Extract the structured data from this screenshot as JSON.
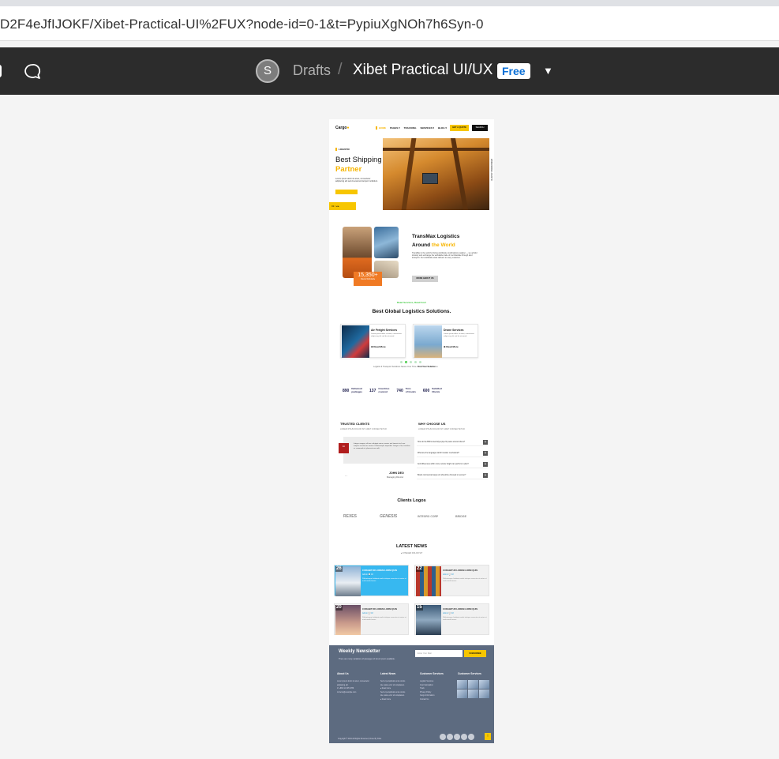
{
  "browser": {
    "url": "D2F4eJfIJOKF/Xibet-Practical-UI%2FUX?node-id=0-1&t=PypiuXgNOh7h6Syn-0"
  },
  "figma": {
    "avatar_initial": "S",
    "breadcrumb_drafts": "Drafts",
    "separator": "/",
    "file_title": "Xibet Practical UI/UX",
    "plan_badge": "Free",
    "chevron": "⌄"
  },
  "design": {
    "nav": {
      "logo_prefix": "Cargo",
      "logo_suffix": "●",
      "items": [
        "HOME",
        "PAGES ▾",
        "TRACKING",
        "SERVICES ▾",
        "BLOG ▾"
      ],
      "cta": "GET A QUOTE",
      "search": "SEARCH"
    },
    "hero": {
      "tag": "LOGISTIC",
      "title_line1": "Best Shipping",
      "title_line2": "Partner",
      "paragraph": "Lorem ipsum dolor sit amet, consectetur adipiscing elit sed do eiusmod tempor incididunt.",
      "side_text": "WORLDWIDE LOGISTIC",
      "controls": "01 / ◂ ▸"
    },
    "about": {
      "stat_number": "15,350+",
      "stat_label": "Clients Worldwide",
      "title_line1": "TransMax Logistics",
      "title_line2_prefix": "Around ",
      "title_line2_accent": "the World",
      "paragraph": "TransMax is the world's driving worldwide coordinations supplier — we uphold industry and exchange the worldwide trade of merchandise through land transport. Our worldwide scale delivers to every customer.",
      "button": "MORE ABOUT US"
    },
    "services": {
      "tag": "Read Services, Read Con!",
      "title": "Best Global Logistics Solutions.",
      "cards": [
        {
          "title": "Air Freight Services",
          "desc": "Lorem ipsum dolor sit amet, consectetur adipiscing elit sed do eiusmod.",
          "link": "Read More"
        },
        {
          "title": "Drone Services",
          "desc": "Lorem ipsum dolor sit amet, consectetur adipiscing elit sed do eiusmod.",
          "link": "Read More"
        }
      ],
      "footer_text": "Logistic & Transport Solutions Saves Your Time.",
      "footer_link": "Find Your Solution"
    },
    "counters": [
      {
        "number": "890",
        "label_1": "Delivered",
        "label_2": "packages"
      },
      {
        "number": "137",
        "label_1": "Countries",
        "label_2": "covered"
      },
      {
        "number": "740",
        "label_1": "Tons",
        "label_2": "of Goods"
      },
      {
        "number": "600",
        "label_1": "Satisfied",
        "label_2": "Clients"
      }
    ],
    "clients": {
      "title": "TRUSTED CLIENTS",
      "subtitle": "LOREM IPSUM DOLOR SIT AMET CONSECTETUR",
      "quote_mark": "“",
      "quote": "Integer semper, elit nec volutpat varius, mauris nisi laoreet nisl, non tempus est elit nec mauris. Pellentesque imperdiet. Integer a leo, faucibus ac commodo at, placerat non velit.",
      "name": "JOHN DEO",
      "role": "Managing Director",
      "nav": "‹ ›"
    },
    "why": {
      "title": "WHY CHOOSE US",
      "subtitle": "LOREM IPSUM DOLOR SIT AMET CONSECTETUR",
      "faqs": [
        "How do the Bhlimt electrolyte pipe fit power around others?",
        "What are the languages which transfer mechanical?",
        "And differences within more remote freight can perform to plan?",
        "Brand commercial cargo unit should be choosed to recover?"
      ],
      "plus": "+"
    },
    "logos": {
      "title": "Clients Logos",
      "items": [
        "REXES",
        "GENESIS",
        "INTEGRO CORP",
        "BRIDGE"
      ]
    },
    "news": {
      "title": "LATEST NEWS",
      "subtitle": "● INTEGER DOLOR SIT",
      "cards": [
        {
          "date": "26",
          "title": "CURABITUR LOREM LORM QUIS",
          "meta": "Admin  💬  18",
          "text": "Pellentesque habitant morbi tristique senectus et netus et malesuada fames."
        },
        {
          "date": "22",
          "title": "CURABITUR LOREM LORM QUIS",
          "meta": "Admin  💬  18",
          "text": "Pellentesque habitant morbi tristique senectus et netus et malesuada fames."
        },
        {
          "date": "20",
          "title": "CURABITUR LOREM LORM QUIS",
          "meta": "Admin  💬  18",
          "text": "Pellentesque habitant morbi tristique senectus et netus et malesuada fames."
        },
        {
          "date": "15",
          "title": "CURABITUR LOREM LORM QUIS",
          "meta": "Admin  💬  18",
          "text": "Pellentesque habitant morbi tristique senectus et netus et malesuada fames."
        }
      ]
    },
    "footer": {
      "newsletter_title": "Weekly Newsletter",
      "newsletter_sub": "There are many variations of passages of lorem ipsum available.",
      "email_placeholder": "Enter Your Mail",
      "subscribe": "SUBSCRIBE",
      "about_title": "About Us",
      "about_lines": [
        "Lorem ipsum dolor sit amet, consectetur",
        "adipiscing elit.",
        "",
        "✆  +880 12 345 6789",
        "✉  demo@example.com"
      ],
      "news_title": "Latest News",
      "news_lines": [
        "Sed ut perspiciatis unde omnis",
        "iste natus error sit voluptatem.",
        "▸ Read more",
        "",
        "Sed ut perspiciatis unde omnis",
        "iste natus error sit voluptatem.",
        "▸ Read more"
      ],
      "service_title": "Customer Services",
      "service_lines": [
        "Logistic Services",
        "Cost Calculation",
        "Track",
        "Privacy Policy",
        "Cargo Information",
        "Contact Us"
      ],
      "gallery_title": "Customer Services",
      "copyright": "Copyright © 2021 All Rights Reserved | Done By Xibet",
      "to_top": "↑"
    }
  }
}
